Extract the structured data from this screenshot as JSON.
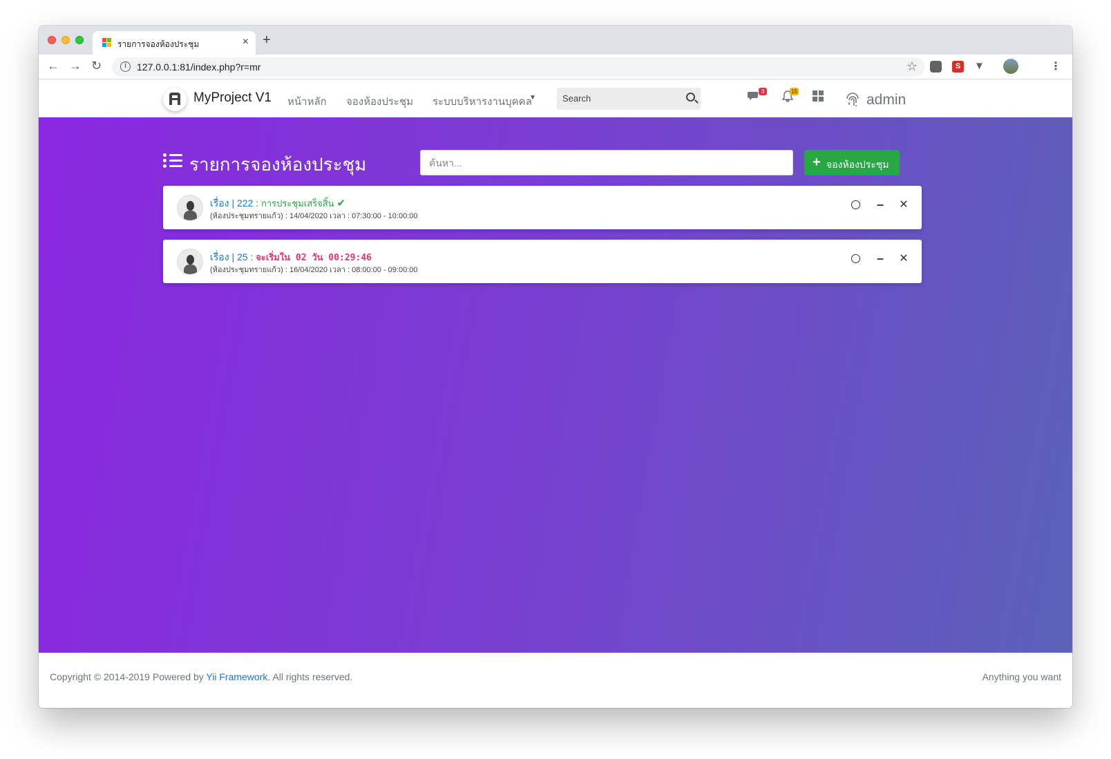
{
  "browser": {
    "tab_title": "รายการจองห้องประชุม",
    "url": "127.0.0.1:81/index.php?r=mr",
    "new_tab_glyph": "+",
    "close_glyph": "×"
  },
  "navbar": {
    "brand": "MyProject V1",
    "links": [
      "หน้าหลัก",
      "จองห้องประชุม",
      "ระบบบริหารงานบุคคล"
    ],
    "search_placeholder": "Search",
    "messages_count": "3",
    "notifications_count": "15",
    "user": "admin"
  },
  "page": {
    "title": "รายการจองห้องประชุม",
    "search_placeholder": "ค้นหา...",
    "add_button": "จองห้องประชุม"
  },
  "bookings": [
    {
      "subject_label": "เรื่อง | 222",
      "sep": ":",
      "status": "การประชุมเสร็จสิ้น",
      "status_type": "done",
      "details": "(ห้องประชุมทรายแก้ว) : 14/04/2020 เวลา : 07:30:00 - 10:00:00"
    },
    {
      "subject_label": "เรื่อง | 25",
      "sep": ":",
      "status": "จะเริ่มใน 02 วัน 00:29:46",
      "status_type": "countdown",
      "details": "(ห้องประชุมทรายแก้ว) : 16/04/2020 เวลา : 08:00:00 - 09:00:00"
    }
  ],
  "footer": {
    "copyright_prefix": "Copyright © 2014-2019 Powered by ",
    "framework_link": "Yii Framework",
    "copyright_suffix": ". All rights reserved.",
    "right_text": "Anything you want"
  },
  "colors": {
    "gradient_start": "#8a27e0",
    "gradient_end": "#5a62b8",
    "success": "#28a745",
    "link": "#1877d2",
    "countdown": "#e8336d"
  }
}
